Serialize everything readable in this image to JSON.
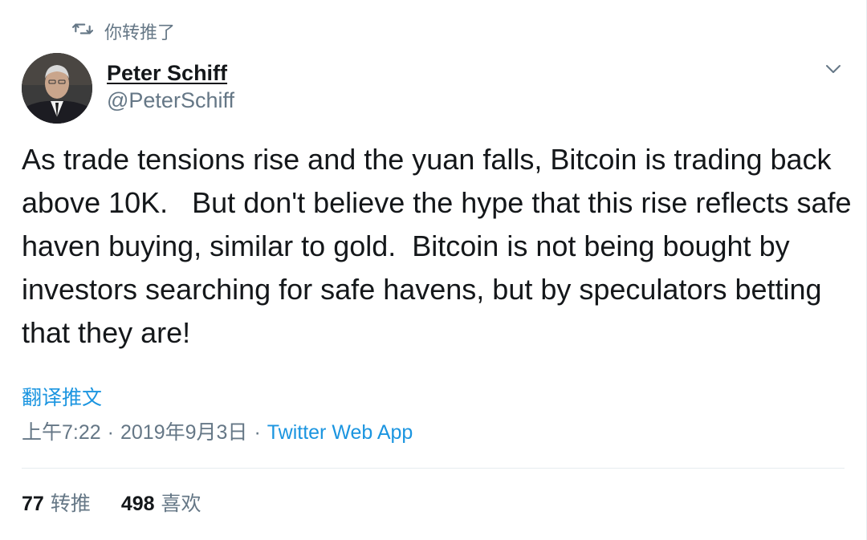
{
  "retweet_context": {
    "icon": "retweet-icon",
    "text": "你转推了"
  },
  "author": {
    "display_name": "Peter Schiff",
    "handle": "@PeterSchiff"
  },
  "tweet": {
    "text": "As trade tensions rise and the yuan falls, Bitcoin is trading back above 10K.   But don't believe the hype that this rise reflects safe haven buying, similar to gold.  Bitcoin is not being bought by investors searching for safe havens, but by speculators betting that they are!",
    "translate_label": "翻译推文"
  },
  "meta": {
    "time": "上午7:22",
    "separator": "·",
    "date": "2019年9月3日",
    "source": "Twitter Web App"
  },
  "stats": {
    "retweets_count": "77",
    "retweets_label": "转推",
    "likes_count": "498",
    "likes_label": "喜欢"
  },
  "colors": {
    "link": "#1b95e0",
    "secondary_text": "#657786",
    "primary_text": "#14171a",
    "divider": "#e6ecf0"
  }
}
